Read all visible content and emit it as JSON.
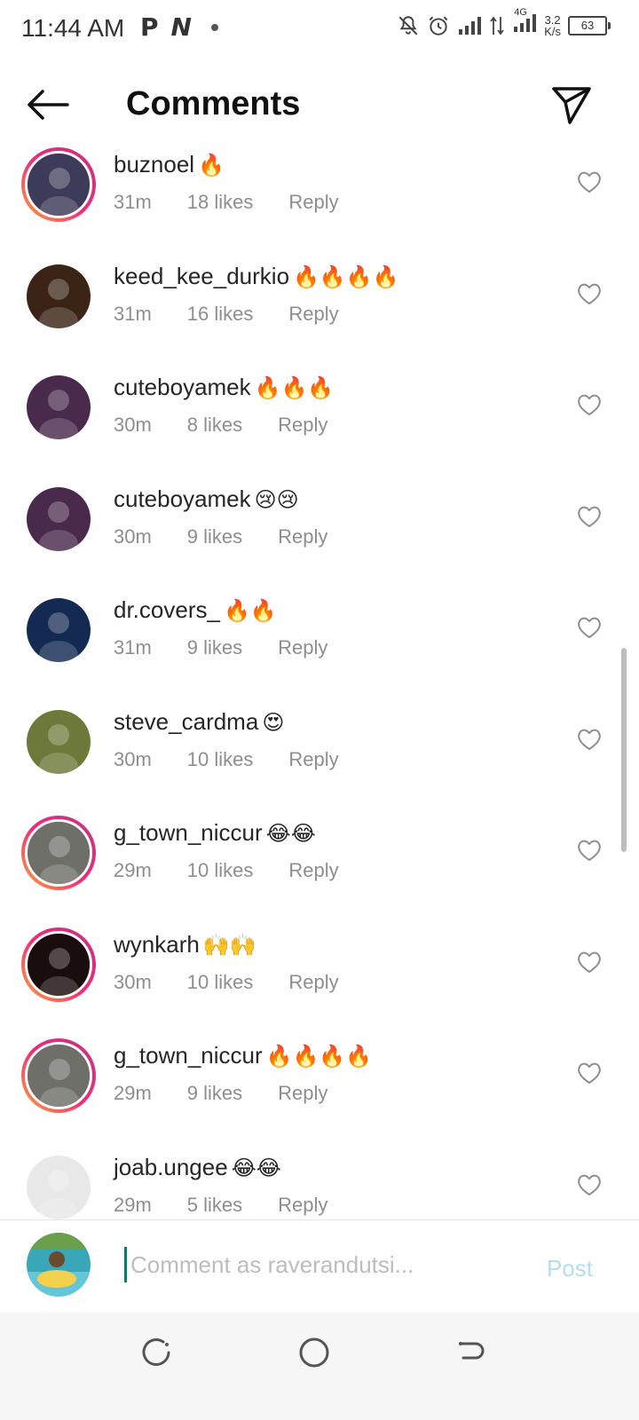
{
  "status": {
    "time": "11:44 AM",
    "left_icons": [
      "P",
      "N"
    ],
    "network": "4G",
    "speed_value": "3.2",
    "speed_unit": "K/s",
    "battery": "63"
  },
  "header": {
    "title": "Comments",
    "back_icon": "arrow-left-icon",
    "send_icon": "paper-plane-icon"
  },
  "comments": [
    {
      "username": "buznoel",
      "emoji": "🔥",
      "time": "31m",
      "likes": "18 likes",
      "reply": "Reply",
      "story": true,
      "avatar_color": "#3d3b5a"
    },
    {
      "username": "keed_kee_durkio",
      "emoji": "🔥🔥🔥🔥",
      "time": "31m",
      "likes": "16 likes",
      "reply": "Reply",
      "story": false,
      "avatar_color": "#3b2416"
    },
    {
      "username": "cuteboyamek",
      "emoji": "🔥🔥🔥",
      "time": "30m",
      "likes": "8 likes",
      "reply": "Reply",
      "story": false,
      "avatar_color": "#4a2a4c"
    },
    {
      "username": "cuteboyamek",
      "emoji": "😢😢",
      "time": "30m",
      "likes": "9 likes",
      "reply": "Reply",
      "story": false,
      "avatar_color": "#4a2a4c"
    },
    {
      "username": "dr.covers_",
      "emoji": "🔥🔥",
      "time": "31m",
      "likes": "9 likes",
      "reply": "Reply",
      "story": false,
      "avatar_color": "#142a52"
    },
    {
      "username": "steve_cardma",
      "emoji": "😍",
      "time": "30m",
      "likes": "10 likes",
      "reply": "Reply",
      "story": false,
      "avatar_color": "#6b7a3a"
    },
    {
      "username": "g_town_niccur",
      "emoji": "😂😂",
      "time": "29m",
      "likes": "10 likes",
      "reply": "Reply",
      "story": true,
      "avatar_color": "#6f6f6a"
    },
    {
      "username": "wynkarh",
      "emoji": "🙌🙌",
      "time": "30m",
      "likes": "10 likes",
      "reply": "Reply",
      "story": true,
      "avatar_color": "#1a0d0d"
    },
    {
      "username": "g_town_niccur",
      "emoji": "🔥🔥🔥🔥",
      "time": "29m",
      "likes": "9 likes",
      "reply": "Reply",
      "story": true,
      "avatar_color": "#6f6f6a"
    },
    {
      "username": "joab.ungee",
      "emoji": "😂😂",
      "time": "29m",
      "likes": "5 likes",
      "reply": "Reply",
      "story": false,
      "avatar_color": "#e8e8e8"
    }
  ],
  "composer": {
    "placeholder": "Comment as raverandutsi...",
    "post_label": "Post"
  },
  "nav": [
    "recent-apps-icon",
    "home-icon",
    "back-icon"
  ]
}
